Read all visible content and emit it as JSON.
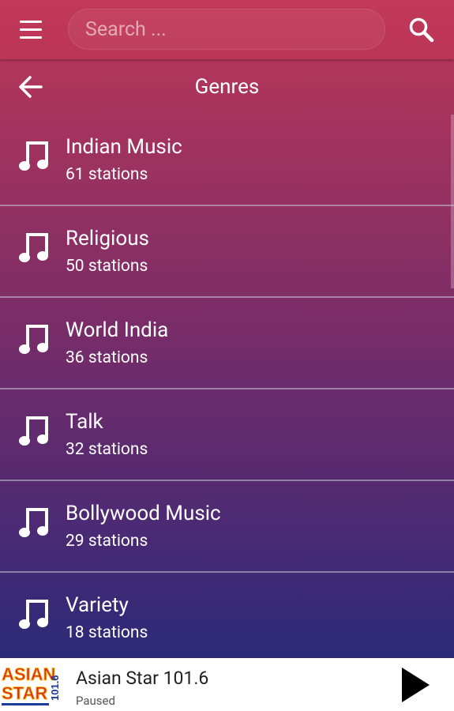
{
  "search": {
    "placeholder": "Search ..."
  },
  "header": {
    "title": "Genres"
  },
  "genres": [
    {
      "name": "Indian Music",
      "count": "61 stations"
    },
    {
      "name": "Religious",
      "count": "50 stations"
    },
    {
      "name": "World India",
      "count": "36 stations"
    },
    {
      "name": "Talk",
      "count": "32 stations"
    },
    {
      "name": "Bollywood Music",
      "count": "29 stations"
    },
    {
      "name": "Variety",
      "count": "18 stations"
    }
  ],
  "player": {
    "station": "Asian Star 101.6",
    "status": "Paused",
    "logo_text_1": "ASIAN",
    "logo_text_2": "STAR",
    "logo_freq": "101.6"
  },
  "icons": {
    "menu": "hamburger-menu-icon",
    "search": "search-icon",
    "back": "back-arrow-icon",
    "genre": "music-note-icon",
    "play": "play-icon"
  },
  "colors": {
    "toolbar": "#c23858",
    "gradient_top": "#c0385a",
    "gradient_bottom": "#262978",
    "text": "#ffffff",
    "divider": "#c8c8d7"
  }
}
